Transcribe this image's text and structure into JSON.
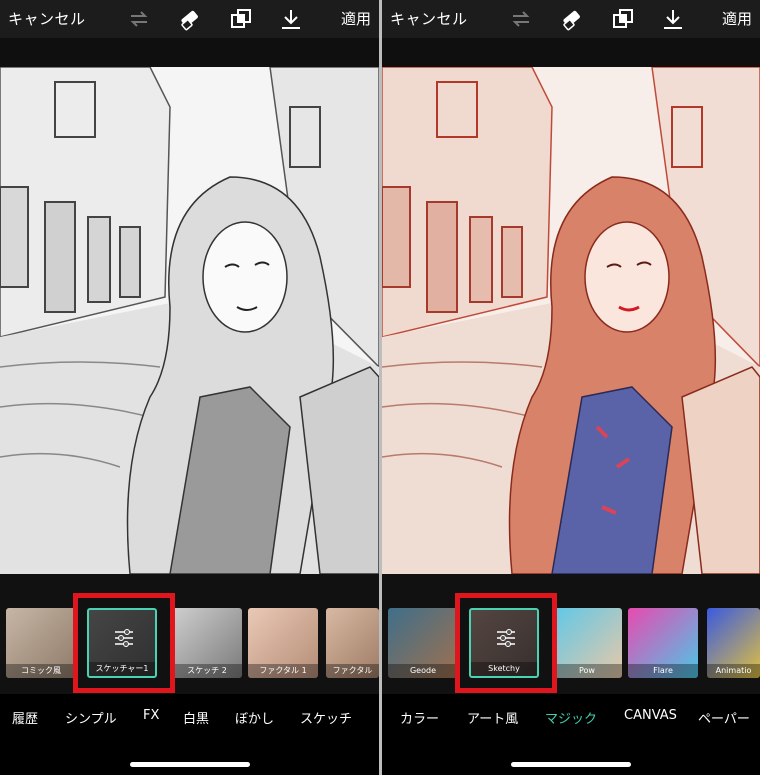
{
  "left": {
    "topbar": {
      "cancel": "キャンセル",
      "apply": "適用",
      "icons": [
        "repeat-icon",
        "eraser-icon",
        "blend-icon",
        "download-icon"
      ]
    },
    "effects": [
      {
        "label": "コミック風"
      },
      {
        "label": "スケッチャー1",
        "selected": true
      },
      {
        "label": "スケッチ 2"
      },
      {
        "label": "ファクタル 1"
      },
      {
        "label": "ファクタル"
      }
    ],
    "categories": [
      "履歴",
      "シンプル",
      "FX",
      "白黒",
      "ぼかし",
      "スケッチ"
    ]
  },
  "right": {
    "topbar": {
      "cancel": "キャンセル",
      "apply": "適用",
      "icons": [
        "repeat-icon",
        "eraser-icon",
        "blend-icon",
        "download-icon"
      ]
    },
    "effects": [
      {
        "label": "Geode"
      },
      {
        "label": "Sketchy",
        "selected": true
      },
      {
        "label": "Pow"
      },
      {
        "label": "Flare"
      },
      {
        "label": "Animatio"
      }
    ],
    "categories": [
      "カラー",
      "アート風",
      "マジック",
      "CANVAS",
      "ペーパー"
    ],
    "active_category": "マジック"
  },
  "colors": {
    "accent": "#3fd1b0",
    "highlight": "#e0161e",
    "topbar": "#1c1c1c"
  }
}
